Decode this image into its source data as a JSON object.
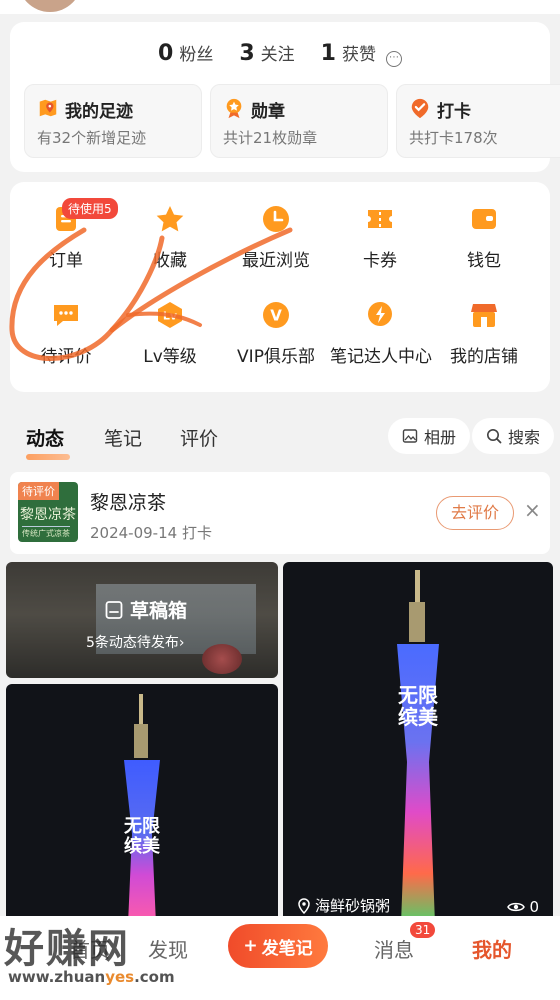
{
  "stats": [
    {
      "num": "0",
      "label": "粉丝"
    },
    {
      "num": "3",
      "label": "关注"
    },
    {
      "num": "1",
      "label": "获赞"
    }
  ],
  "tiles": [
    {
      "title": "我的足迹",
      "sub": "有32个新增足迹",
      "icon": "map-pin-icon"
    },
    {
      "title": "勋章",
      "sub": "共计21枚勋章",
      "icon": "medal-icon"
    },
    {
      "title": "打卡",
      "sub": "共打卡178次",
      "icon": "check-in-icon"
    }
  ],
  "functions": {
    "row1": [
      {
        "label": "订单",
        "icon": "order-icon",
        "badge": "待使用5"
      },
      {
        "label": "收藏",
        "icon": "star-icon"
      },
      {
        "label": "最近浏览",
        "icon": "clock-icon"
      },
      {
        "label": "卡券",
        "icon": "coupon-icon"
      },
      {
        "label": "钱包",
        "icon": "wallet-icon"
      }
    ],
    "row2": [
      {
        "label": "待评价",
        "icon": "review-icon"
      },
      {
        "label": "Lv等级",
        "icon": "level-icon",
        "glyph": "Lv"
      },
      {
        "label": "VIP俱乐部",
        "icon": "vip-icon",
        "glyph": "V"
      },
      {
        "label": "笔记达人中心",
        "icon": "creator-icon"
      },
      {
        "label": "我的店铺",
        "icon": "shop-icon"
      }
    ]
  },
  "tabs": [
    "动态",
    "笔记",
    "评价"
  ],
  "actions": {
    "album": "相册",
    "search": "搜索"
  },
  "review": {
    "tag": "待评价",
    "thumb_text": "黎恩凉茶",
    "thumb_sub": "传统广式凉茶",
    "name": "黎恩凉茶",
    "date": "2024-09-14",
    "action": "打卡",
    "button": "去评价",
    "close": "×"
  },
  "draft": {
    "title": "草稿箱",
    "sub": "5条动态待发布",
    "arrow": "›"
  },
  "tower_screen": "无限\n缤美",
  "post": {
    "location": "海鲜砂锅粥",
    "views": "0"
  },
  "bottom_nav": {
    "home": "首页",
    "discover": "发现",
    "post": "发笔记",
    "post_plus": "+",
    "messages": "消息",
    "messages_badge": "31",
    "mine": "我的"
  },
  "watermark": {
    "big": "好赚网",
    "small_pre": "www.zhuan",
    "small_hl": "yes",
    "small_post": ".com"
  },
  "colors": {
    "accent": "#e5562c",
    "icon_orange": "#ff9a1f",
    "badge_red": "#f2493b",
    "scribble": "#f06a2a"
  }
}
